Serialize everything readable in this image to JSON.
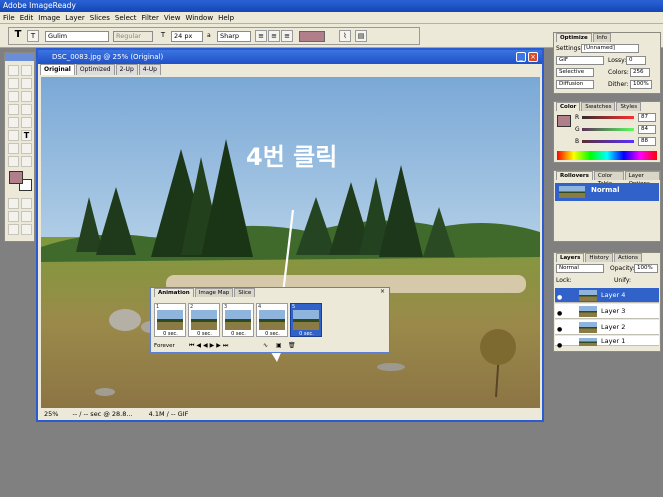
{
  "app": {
    "title": "Adobe ImageReady"
  },
  "menu": [
    "File",
    "Edit",
    "Image",
    "Layer",
    "Slices",
    "Select",
    "Filter",
    "View",
    "Window",
    "Help"
  ],
  "options": {
    "font_family": "Gulim",
    "font_style": "Regular",
    "font_size": "24 px",
    "antialias_label": "a",
    "antialias": "Sharp"
  },
  "document": {
    "title": "DSC_0083.jpg @ 25% (Original)",
    "tabs": [
      "Original",
      "Optimized",
      "2-Up",
      "4-Up"
    ],
    "annotation": "4번 클릭",
    "status": {
      "zoom": "25%",
      "speed": "-- / -- sec @ 28.8...",
      "size": "4.1M / -- GIF"
    }
  },
  "animation": {
    "tabs": [
      "Animation",
      "Image Map",
      "Slice"
    ],
    "frames": [
      {
        "num": "1",
        "delay": "0 sec."
      },
      {
        "num": "2",
        "delay": "0 sec."
      },
      {
        "num": "3",
        "delay": "0 sec."
      },
      {
        "num": "4",
        "delay": "0 sec."
      },
      {
        "num": "5",
        "delay": "0 sec."
      }
    ],
    "loop": "Forever"
  },
  "optimize": {
    "tabs": [
      "Optimize",
      "Info"
    ],
    "settings_label": "Settings:",
    "settings": "[Unnamed]",
    "format": "GIF",
    "lossy_label": "Lossy:",
    "lossy": "0",
    "palette": "Selective",
    "colors_label": "Colors:",
    "colors": "256",
    "dither_method": "Diffusion",
    "dither_label": "Dither:",
    "dither": "100%"
  },
  "color": {
    "tabs": [
      "Color",
      "Swatches",
      "Styles"
    ],
    "r_label": "R",
    "r": "87",
    "g_label": "G",
    "g": "84",
    "b_label": "B",
    "b": "88",
    "swatch": "#b07f89"
  },
  "rollovers": {
    "tabs": [
      "Rollovers",
      "Color Table",
      "Layer Options"
    ],
    "state": "Normal"
  },
  "layers": {
    "tabs": [
      "Layers",
      "History",
      "Actions"
    ],
    "blend": "Normal",
    "opacity_label": "Opacity:",
    "opacity": "100%",
    "lock_label": "Lock:",
    "unify_label": "Unify:",
    "items": [
      "Layer 4",
      "Layer 3",
      "Layer 2",
      "Layer 1"
    ]
  }
}
